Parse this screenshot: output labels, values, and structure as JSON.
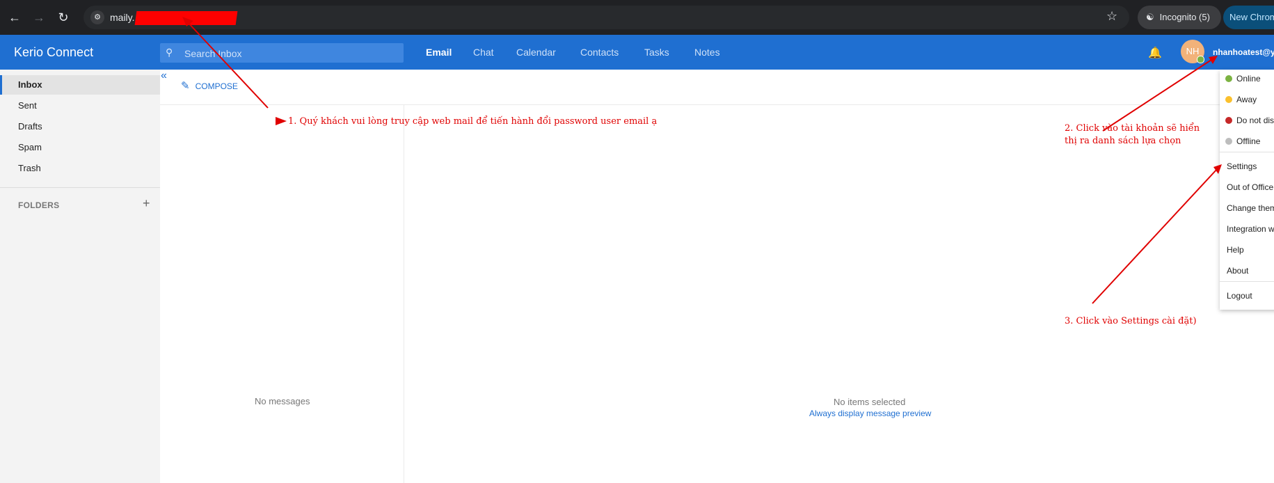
{
  "browser": {
    "url": "maily............bmail/#mail",
    "incognito_label": "Incognito (5)",
    "new_chrome_label": "New Chrome",
    "back_icon": "arrow-left-icon",
    "forward_icon": "arrow-right-icon",
    "reload_icon": "reload-icon"
  },
  "app": {
    "name": "Kerio Connect",
    "search_placeholder": "Search Inbox",
    "tabs": [
      "Email",
      "Chat",
      "Calendar",
      "Contacts",
      "Tasks",
      "Notes"
    ],
    "active_tab": "Email",
    "avatar_initials": "NH",
    "user": "nhanhoatest@yu"
  },
  "sidebar": {
    "items": [
      "Inbox",
      "Sent",
      "Drafts",
      "Spam",
      "Trash"
    ],
    "active": "Inbox",
    "folders_label": "FOLDERS"
  },
  "main": {
    "compose_label": "COMPOSE",
    "no_messages": "No messages",
    "no_selection": "No items selected",
    "preview_link": "Always display message preview"
  },
  "dropdown": {
    "statuses": [
      {
        "label": "Online",
        "color": "#7cb342"
      },
      {
        "label": "Away",
        "color": "#fbc02d"
      },
      {
        "label": "Do not dis",
        "color": "#c62828"
      },
      {
        "label": "Offline",
        "color": "#bdbdbd"
      }
    ],
    "items": [
      "Settings",
      "Out of Office",
      "Change them",
      "Integration w",
      "Help",
      "About"
    ],
    "logout": "Logout"
  },
  "annotations": {
    "step1": "1. Quý khách vui lòng truy cập web mail để tiến hành đổi password user email ạ",
    "step2_line1": "2. Click vào tài khoản sẽ hiển",
    "step2_line2": "thị ra danh sách lựa chọn",
    "step3": "3. Click vào Settings cài đặt)"
  },
  "colors": {
    "accent": "#1f6fd1",
    "annotation": "#e00000"
  }
}
